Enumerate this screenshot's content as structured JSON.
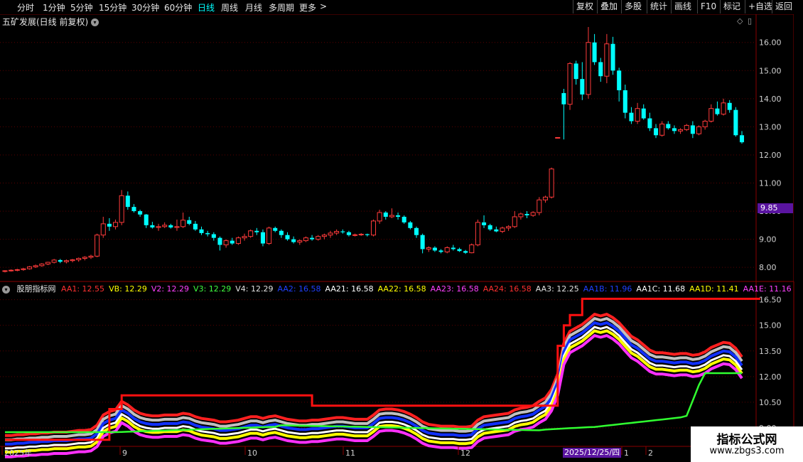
{
  "toolbar": {
    "periods": [
      "分时",
      "1分钟",
      "5分钟",
      "15分钟",
      "30分钟",
      "60分钟",
      "日线",
      "周线",
      "月线",
      "多周期",
      "更多"
    ],
    "active_period": "日线",
    "more_arrow": ">",
    "right_buttons": [
      "复权",
      "叠加",
      "多股",
      "统计",
      "画线",
      "F10",
      "标记",
      "+自选",
      "返回"
    ]
  },
  "main": {
    "title": "五矿发展(日线 前复权)",
    "price_tag": "9.85",
    "y_labels": [
      "16.00",
      "15.00",
      "14.00",
      "13.00",
      "12.00",
      "11.00",
      "10.00",
      "9.00",
      "8.00"
    ],
    "y_values": [
      16,
      15,
      14,
      13,
      12,
      11,
      10,
      9,
      8
    ],
    "up_color": "#ff3b3b",
    "down_color": "#00ffff"
  },
  "indicator": {
    "title": "股朋指标网",
    "items": [
      {
        "label": "AA1: 12.55",
        "color": "#ff3030"
      },
      {
        "label": "VB: 12.29",
        "color": "#ffff00"
      },
      {
        "label": "V2: 12.29",
        "color": "#ff40ff"
      },
      {
        "label": "V3: 12.29",
        "color": "#40ff40"
      },
      {
        "label": "V4: 12.29",
        "color": "#e0e0e0"
      },
      {
        "label": "AA2: 16.58",
        "color": "#2040ff"
      },
      {
        "label": "AA21: 16.58",
        "color": "#ffffff"
      },
      {
        "label": "AA22: 16.58",
        "color": "#ffff00"
      },
      {
        "label": "AA23: 16.58",
        "color": "#ff40ff"
      },
      {
        "label": "AA24: 16.58",
        "color": "#ff3030"
      },
      {
        "label": "AA3: 12.25",
        "color": "#e0e0e0"
      },
      {
        "label": "AA1B: 11.96",
        "color": "#2040ff"
      },
      {
        "label": "AA1C: 11.68",
        "color": "#ffffff"
      },
      {
        "label": "AA1D: 11.41",
        "color": "#ffff00"
      },
      {
        "label": "AA1E: 11.16",
        "color": "#ff40ff"
      }
    ],
    "y_labels": [
      "16.50",
      "15.00",
      "13.50",
      "12.00",
      "10.50",
      "9.00"
    ],
    "y_values": [
      16.5,
      15,
      13.5,
      12,
      10.5,
      9
    ]
  },
  "x_axis": {
    "labels": [
      {
        "text": "2025年",
        "idx": 0
      },
      {
        "text": "9",
        "idx": 21
      },
      {
        "text": "10",
        "idx": 43
      },
      {
        "text": "11",
        "idx": 60
      },
      {
        "text": "12",
        "idx": 80
      },
      {
        "text": "1",
        "idx": 112
      },
      {
        "text": "2",
        "idx": 113
      }
    ],
    "cursor_date": "2025/12/25/四"
  },
  "watermark": {
    "title": "指标公式网",
    "url": "www.zbgs3.com"
  },
  "chart_data": {
    "type": "candlestick",
    "series_ohlc": [
      [
        7.86,
        7.9,
        7.82,
        7.88
      ],
      [
        7.88,
        7.93,
        7.85,
        7.9
      ],
      [
        7.9,
        7.95,
        7.86,
        7.92
      ],
      [
        7.92,
        7.98,
        7.88,
        7.95
      ],
      [
        7.95,
        8.05,
        7.92,
        8.02
      ],
      [
        8.02,
        8.1,
        7.98,
        8.06
      ],
      [
        8.06,
        8.15,
        8.02,
        8.12
      ],
      [
        8.12,
        8.2,
        8.08,
        8.18
      ],
      [
        8.18,
        8.3,
        8.14,
        8.26
      ],
      [
        8.26,
        8.3,
        8.15,
        8.2
      ],
      [
        8.2,
        8.28,
        8.14,
        8.24
      ],
      [
        8.24,
        8.3,
        8.18,
        8.27
      ],
      [
        8.27,
        8.35,
        8.2,
        8.32
      ],
      [
        8.32,
        8.4,
        8.25,
        8.36
      ],
      [
        8.36,
        8.45,
        8.3,
        8.4
      ],
      [
        8.4,
        9.2,
        8.36,
        9.15
      ],
      [
        9.15,
        9.8,
        9.05,
        9.55
      ],
      [
        9.55,
        9.75,
        9.3,
        9.45
      ],
      [
        9.45,
        9.7,
        9.35,
        9.6
      ],
      [
        9.6,
        10.75,
        9.5,
        10.55
      ],
      [
        10.55,
        10.7,
        10.05,
        10.15
      ],
      [
        10.15,
        10.25,
        9.95,
        10.0
      ],
      [
        10.0,
        10.05,
        9.8,
        9.88
      ],
      [
        9.88,
        9.9,
        9.4,
        9.5
      ],
      [
        9.5,
        9.62,
        9.38,
        9.42
      ],
      [
        9.42,
        9.55,
        9.3,
        9.45
      ],
      [
        9.45,
        9.6,
        9.4,
        9.5
      ],
      [
        9.5,
        9.55,
        9.38,
        9.42
      ],
      [
        9.42,
        9.7,
        9.3,
        9.45
      ],
      [
        9.45,
        9.95,
        9.4,
        9.68
      ],
      [
        9.68,
        9.8,
        9.5,
        9.55
      ],
      [
        9.55,
        9.65,
        9.3,
        9.35
      ],
      [
        9.35,
        9.45,
        9.15,
        9.22
      ],
      [
        9.22,
        9.3,
        9.1,
        9.18
      ],
      [
        9.18,
        9.25,
        8.95,
        9.05
      ],
      [
        9.05,
        9.1,
        8.6,
        8.8
      ],
      [
        8.8,
        9.0,
        8.7,
        8.95
      ],
      [
        8.95,
        9.05,
        8.8,
        8.85
      ],
      [
        8.85,
        9.1,
        8.8,
        9.05
      ],
      [
        9.05,
        9.2,
        8.95,
        9.1
      ],
      [
        9.1,
        9.35,
        9.05,
        9.3
      ],
      [
        9.3,
        9.4,
        9.15,
        9.25
      ],
      [
        9.25,
        9.35,
        8.75,
        8.85
      ],
      [
        8.85,
        9.45,
        8.8,
        9.4
      ],
      [
        9.4,
        9.45,
        9.25,
        9.3
      ],
      [
        9.3,
        9.35,
        9.05,
        9.15
      ],
      [
        9.15,
        9.25,
        8.95,
        9.0
      ],
      [
        9.0,
        9.1,
        8.85,
        8.9
      ],
      [
        8.9,
        9.0,
        8.8,
        8.95
      ],
      [
        8.95,
        9.1,
        8.9,
        9.05
      ],
      [
        9.05,
        9.15,
        8.95,
        9.0
      ],
      [
        9.0,
        9.15,
        8.95,
        9.1
      ],
      [
        9.1,
        9.2,
        9.0,
        9.15
      ],
      [
        9.15,
        9.3,
        9.05,
        9.22
      ],
      [
        9.22,
        9.35,
        9.15,
        9.28
      ],
      [
        9.28,
        9.35,
        9.2,
        9.25
      ],
      [
        9.25,
        9.3,
        9.1,
        9.15
      ],
      [
        9.15,
        9.2,
        9.1,
        9.16
      ],
      [
        9.16,
        9.22,
        9.12,
        9.18
      ],
      [
        9.18,
        9.2,
        9.1,
        9.15
      ],
      [
        9.15,
        9.7,
        9.1,
        9.65
      ],
      [
        9.65,
        10.05,
        9.55,
        9.95
      ],
      [
        9.95,
        10.0,
        9.7,
        9.8
      ],
      [
        9.8,
        10.1,
        9.75,
        9.85
      ],
      [
        9.85,
        9.95,
        9.7,
        9.8
      ],
      [
        9.8,
        9.85,
        9.55,
        9.6
      ],
      [
        9.6,
        9.65,
        9.35,
        9.4
      ],
      [
        9.4,
        9.45,
        9.05,
        9.15
      ],
      [
        9.15,
        9.2,
        8.5,
        8.65
      ],
      [
        8.65,
        8.75,
        8.55,
        8.7
      ],
      [
        8.7,
        8.75,
        8.55,
        8.6
      ],
      [
        8.6,
        8.65,
        8.5,
        8.55
      ],
      [
        8.55,
        8.75,
        8.5,
        8.7
      ],
      [
        8.7,
        8.8,
        8.6,
        8.65
      ],
      [
        8.65,
        8.7,
        8.55,
        8.58
      ],
      [
        8.58,
        8.62,
        8.48,
        8.52
      ],
      [
        8.52,
        8.85,
        8.5,
        8.8
      ],
      [
        8.8,
        9.7,
        8.75,
        9.6
      ],
      [
        9.6,
        9.85,
        9.4,
        9.5
      ],
      [
        9.5,
        9.55,
        9.3,
        9.35
      ],
      [
        9.35,
        9.45,
        9.25,
        9.28
      ],
      [
        9.28,
        9.45,
        9.22,
        9.4
      ],
      [
        9.4,
        9.5,
        9.3,
        9.45
      ],
      [
        9.45,
        10.0,
        9.4,
        9.8
      ],
      [
        9.8,
        9.95,
        9.7,
        9.9
      ],
      [
        9.9,
        10.0,
        9.75,
        9.85
      ],
      [
        9.85,
        10.0,
        9.8,
        9.95
      ],
      [
        9.95,
        10.5,
        9.85,
        10.4
      ],
      [
        10.4,
        10.55,
        10.3,
        10.5
      ],
      [
        10.5,
        11.55,
        10.45,
        11.5
      ],
      [
        12.62,
        12.62,
        12.62,
        12.62
      ],
      [
        14.2,
        14.35,
        12.55,
        13.8
      ],
      [
        13.8,
        15.3,
        13.6,
        15.25
      ],
      [
        15.25,
        15.35,
        14.5,
        14.7
      ],
      [
        14.7,
        15.3,
        13.95,
        14.15
      ],
      [
        14.15,
        16.55,
        14.0,
        16.0
      ],
      [
        16.0,
        16.3,
        15.2,
        15.3
      ],
      [
        15.3,
        15.45,
        14.6,
        14.8
      ],
      [
        14.8,
        16.3,
        14.55,
        15.95
      ],
      [
        15.95,
        16.2,
        14.85,
        15.0
      ],
      [
        15.0,
        15.1,
        13.9,
        14.3
      ],
      [
        14.3,
        14.5,
        13.3,
        13.5
      ],
      [
        13.5,
        13.7,
        13.1,
        13.2
      ],
      [
        13.2,
        13.85,
        13.1,
        13.65
      ],
      [
        13.65,
        13.8,
        13.25,
        13.3
      ],
      [
        13.3,
        13.5,
        12.85,
        12.95
      ],
      [
        12.95,
        13.1,
        12.6,
        12.7
      ],
      [
        12.7,
        13.2,
        12.65,
        13.1
      ],
      [
        13.1,
        13.2,
        12.9,
        12.95
      ],
      [
        12.95,
        13.05,
        12.75,
        12.85
      ],
      [
        12.85,
        12.95,
        12.75,
        12.9
      ],
      [
        12.9,
        13.1,
        12.85,
        13.05
      ],
      [
        13.05,
        13.2,
        12.6,
        12.75
      ],
      [
        12.75,
        13.05,
        12.7,
        13.0
      ],
      [
        13.0,
        13.25,
        12.9,
        13.2
      ],
      [
        13.2,
        13.8,
        13.15,
        13.65
      ],
      [
        13.65,
        13.9,
        13.4,
        13.45
      ],
      [
        13.45,
        14.0,
        13.4,
        13.85
      ],
      [
        13.85,
        13.95,
        13.5,
        13.6
      ],
      [
        13.6,
        13.7,
        12.65,
        12.7
      ],
      [
        12.7,
        12.85,
        12.4,
        12.45
      ]
    ],
    "indicator_series": {
      "AA1_peak": [
        8.3,
        8.3,
        8.3,
        8.3,
        8.3,
        8.3,
        8.3,
        8.3,
        8.3,
        8.3,
        8.3,
        8.3,
        8.3,
        8.3,
        8.3,
        8.3,
        8.3,
        10.1,
        10.1,
        10.9,
        10.9,
        10.9,
        10.9,
        10.9,
        10.9,
        10.9,
        10.9,
        10.9,
        10.9,
        10.9,
        10.9,
        10.9,
        10.9,
        10.9,
        10.9,
        10.9,
        10.9,
        10.9,
        10.9,
        10.9,
        10.9,
        10.9,
        10.9,
        10.9,
        10.9,
        10.9,
        10.9,
        10.9,
        10.9,
        10.9,
        10.3,
        10.3,
        10.3,
        10.3,
        10.3,
        10.3,
        10.3,
        10.3,
        10.3,
        10.3,
        10.3,
        10.3,
        10.3,
        10.3,
        10.3,
        10.3,
        10.3,
        10.3,
        10.3,
        10.3,
        10.3,
        10.3,
        10.3,
        10.3,
        10.3,
        10.3,
        10.3,
        10.3,
        10.3,
        10.3,
        10.3,
        10.3,
        10.3,
        10.3,
        10.3,
        10.3,
        10.3,
        10.3,
        10.3,
        10.3,
        13.8,
        15.0,
        15.6,
        15.6,
        16.55,
        16.55,
        16.55,
        16.55,
        16.55,
        16.55,
        16.55,
        16.55,
        16.55,
        16.55,
        16.55,
        16.55,
        16.55,
        16.55,
        16.55,
        16.55,
        16.55,
        16.55,
        16.55,
        16.55,
        16.55,
        16.55,
        16.55,
        16.55,
        16.55,
        16.55,
        16.55,
        16.55,
        16.55,
        16.55
      ],
      "band_center": [
        8.0,
        8.0,
        8.05,
        8.05,
        8.1,
        8.1,
        8.15,
        8.15,
        8.2,
        8.2,
        8.2,
        8.25,
        8.3,
        8.3,
        8.35,
        8.6,
        9.2,
        9.4,
        9.5,
        10.0,
        9.8,
        9.5,
        9.3,
        9.2,
        9.15,
        9.15,
        9.2,
        9.2,
        9.2,
        9.3,
        9.25,
        9.1,
        9.0,
        8.95,
        8.9,
        8.8,
        8.8,
        8.85,
        8.9,
        9.0,
        9.1,
        9.1,
        9.0,
        9.1,
        9.15,
        9.05,
        8.95,
        8.9,
        8.85,
        8.85,
        8.9,
        8.9,
        8.95,
        9.0,
        9.05,
        9.05,
        9.0,
        8.95,
        8.95,
        8.95,
        9.2,
        9.5,
        9.55,
        9.55,
        9.5,
        9.4,
        9.25,
        9.05,
        8.8,
        8.65,
        8.6,
        8.55,
        8.55,
        8.55,
        8.5,
        8.5,
        8.55,
        8.9,
        9.1,
        9.15,
        9.2,
        9.25,
        9.3,
        9.5,
        9.6,
        9.65,
        9.75,
        10.0,
        10.2,
        10.7,
        11.6,
        13.4,
        14.1,
        14.3,
        14.5,
        14.8,
        15.1,
        15.0,
        15.1,
        14.9,
        14.6,
        14.2,
        13.8,
        13.6,
        13.3,
        13.0,
        12.85,
        12.85,
        12.8,
        12.75,
        12.8,
        12.8,
        12.7,
        12.75,
        12.9,
        13.15,
        13.3,
        13.45,
        13.4,
        13.1,
        12.6
      ]
    }
  }
}
